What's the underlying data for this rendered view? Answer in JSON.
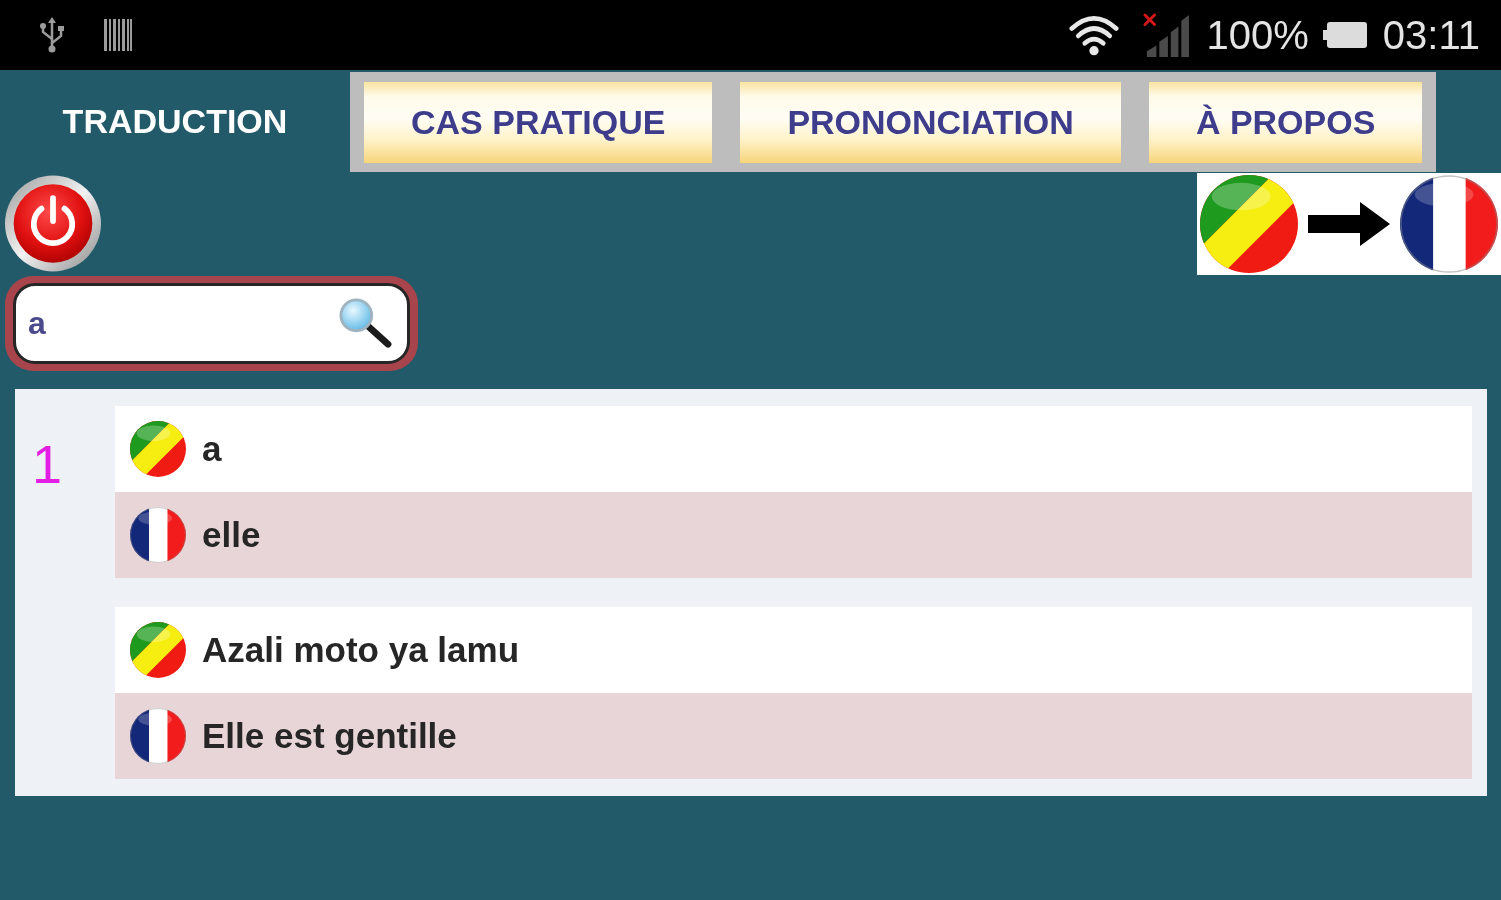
{
  "status_bar": {
    "battery": "100%",
    "time": "03:11"
  },
  "tabs": [
    {
      "label": "TRADUCTION",
      "selected": true
    },
    {
      "label": "CAS PRATIQUE",
      "selected": false
    },
    {
      "label": "PRONONCIATION",
      "selected": false
    },
    {
      "label": "À PROPOS",
      "selected": false
    }
  ],
  "search": {
    "value": "a"
  },
  "results": [
    {
      "number": "1",
      "pairs": [
        {
          "lines": [
            {
              "kind": "lingala",
              "text": "a"
            },
            {
              "kind": "french",
              "text": "elle"
            }
          ]
        },
        {
          "lines": [
            {
              "kind": "lingala",
              "text": "Azali moto ya lamu"
            },
            {
              "kind": "french",
              "text": "Elle est gentille"
            }
          ]
        }
      ]
    }
  ]
}
